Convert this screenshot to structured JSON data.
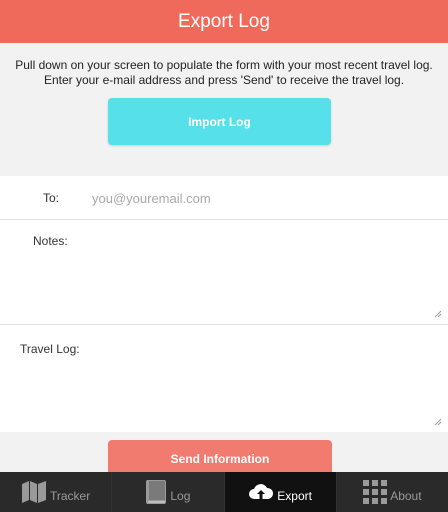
{
  "header": {
    "title": "Export Log"
  },
  "intro": {
    "text": "Pull down on your screen to populate the form with your most recent travel log. Enter your e-mail address and press 'Send' to receive the travel log."
  },
  "import_button": {
    "label": "Import Log"
  },
  "form": {
    "to_label": "To:",
    "email_placeholder": "you@youremail.com",
    "email_value": "",
    "notes_label": "Notes:",
    "travel_log_label": "Travel Log:"
  },
  "send_button": {
    "label": "Send Information"
  },
  "tabs": [
    {
      "label": "Tracker",
      "icon": "map-icon",
      "active": false
    },
    {
      "label": "Log",
      "icon": "book-icon",
      "active": false
    },
    {
      "label": "Export",
      "icon": "cloud-upload-icon",
      "active": true
    },
    {
      "label": "About",
      "icon": "grid-icon",
      "active": false
    }
  ],
  "colors": {
    "header": "#ef6a5a",
    "import_button": "#56e0ea",
    "send_button": "#f07b6e",
    "tabbar": "#2a2a2a"
  }
}
